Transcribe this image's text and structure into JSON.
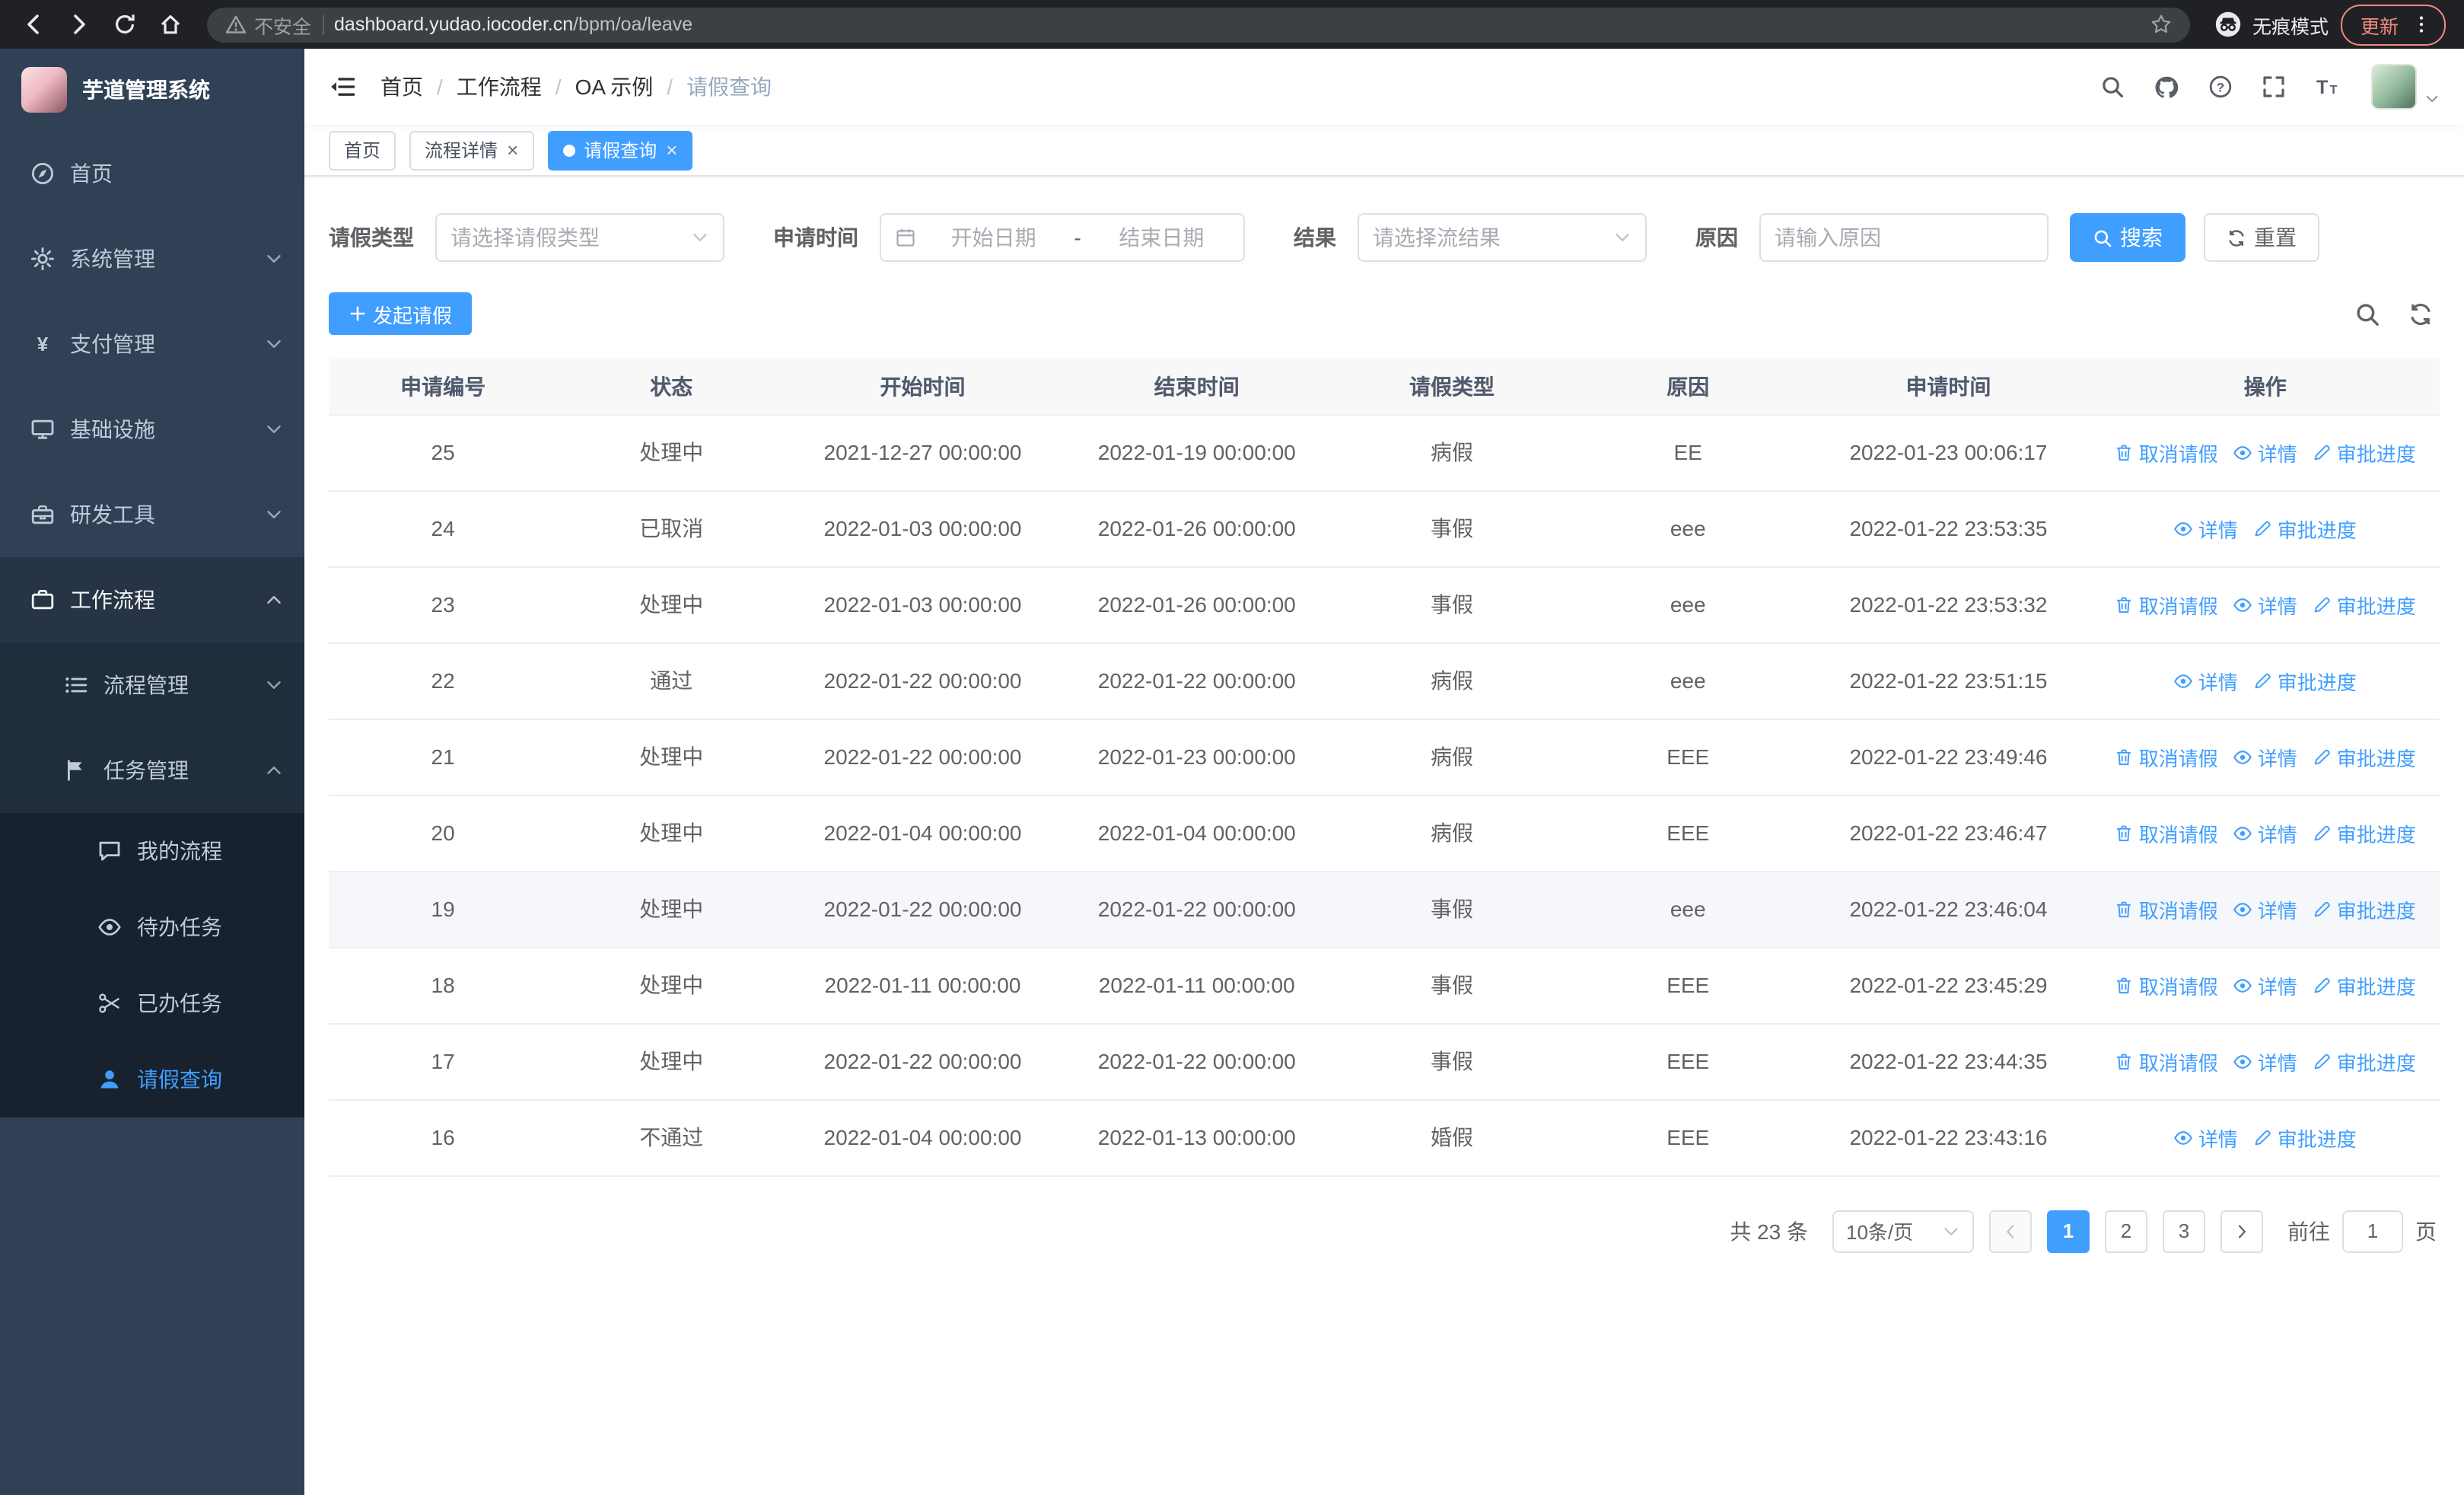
{
  "browser": {
    "security_warning": "不安全",
    "url_host": "dashboard.yudao.iocoder.cn",
    "url_path": "/bpm/oa/leave",
    "incognito_label": "无痕模式",
    "update_button": "更新",
    "nav_icons": [
      "back-icon",
      "forward-icon",
      "reload-icon",
      "home-icon"
    ]
  },
  "sidebar": {
    "logo_title": "芋道管理系统",
    "menu": [
      {
        "id": "home",
        "label": "首页",
        "icon": "dashboard-icon"
      },
      {
        "id": "system",
        "label": "系统管理",
        "icon": "gear-icon",
        "expandable": true
      },
      {
        "id": "payment",
        "label": "支付管理",
        "icon": "yen-icon",
        "expandable": true
      },
      {
        "id": "infra",
        "label": "基础设施",
        "icon": "infra-icon",
        "expandable": true
      },
      {
        "id": "devtools",
        "label": "研发工具",
        "icon": "tools-icon",
        "expandable": true
      },
      {
        "id": "workflow",
        "label": "工作流程",
        "icon": "workflow-icon",
        "expandable": true,
        "expanded": true,
        "children": [
          {
            "id": "process-manage",
            "label": "流程管理",
            "icon": "process-icon",
            "expandable": true
          },
          {
            "id": "task-manage",
            "label": "任务管理",
            "icon": "task-icon",
            "expandable": true,
            "expanded": true,
            "children": [
              {
                "id": "my-process",
                "label": "我的流程",
                "icon": "chat-icon"
              },
              {
                "id": "todo-task",
                "label": "待办任务",
                "icon": "eye-icon"
              },
              {
                "id": "done-task",
                "label": "已办任务",
                "icon": "done-icon"
              },
              {
                "id": "leave-query",
                "label": "请假查询",
                "icon": "user-icon",
                "active": true
              }
            ]
          }
        ]
      }
    ]
  },
  "header": {
    "breadcrumb": [
      "首页",
      "工作流程",
      "OA 示例",
      "请假查询"
    ],
    "icons": [
      "search-icon",
      "github-icon",
      "help-icon",
      "fullscreen-icon",
      "font-size-icon"
    ]
  },
  "tabs": [
    {
      "label": "首页",
      "closable": false,
      "active": false
    },
    {
      "label": "流程详情",
      "closable": true,
      "active": false
    },
    {
      "label": "请假查询",
      "closable": true,
      "active": true
    }
  ],
  "filters": {
    "leave_type": {
      "label": "请假类型",
      "placeholder": "请选择请假类型"
    },
    "apply_time": {
      "label": "申请时间",
      "start_placeholder": "开始日期",
      "separator": "-",
      "end_placeholder": "结束日期"
    },
    "result": {
      "label": "结果",
      "placeholder": "请选择流结果"
    },
    "reason": {
      "label": "原因",
      "placeholder": "请输入原因"
    },
    "search_button": "搜索",
    "reset_button": "重置"
  },
  "toolbar": {
    "create_button": "发起请假"
  },
  "table": {
    "columns": [
      "申请编号",
      "状态",
      "开始时间",
      "结束时间",
      "请假类型",
      "原因",
      "申请时间",
      "操作"
    ],
    "action_labels": {
      "cancel": "取消请假",
      "detail": "详情",
      "progress": "审批进度"
    },
    "rows": [
      {
        "id": "25",
        "status": "处理中",
        "start": "2021-12-27 00:00:00",
        "end": "2022-01-19 00:00:00",
        "type": "病假",
        "reason": "EE",
        "applied": "2022-01-23 00:06:17",
        "actions": [
          "cancel",
          "detail",
          "progress"
        ]
      },
      {
        "id": "24",
        "status": "已取消",
        "start": "2022-01-03 00:00:00",
        "end": "2022-01-26 00:00:00",
        "type": "事假",
        "reason": "eee",
        "applied": "2022-01-22 23:53:35",
        "actions": [
          "detail",
          "progress"
        ]
      },
      {
        "id": "23",
        "status": "处理中",
        "start": "2022-01-03 00:00:00",
        "end": "2022-01-26 00:00:00",
        "type": "事假",
        "reason": "eee",
        "applied": "2022-01-22 23:53:32",
        "actions": [
          "cancel",
          "detail",
          "progress"
        ]
      },
      {
        "id": "22",
        "status": "通过",
        "start": "2022-01-22 00:00:00",
        "end": "2022-01-22 00:00:00",
        "type": "病假",
        "reason": "eee",
        "applied": "2022-01-22 23:51:15",
        "actions": [
          "detail",
          "progress"
        ]
      },
      {
        "id": "21",
        "status": "处理中",
        "start": "2022-01-22 00:00:00",
        "end": "2022-01-23 00:00:00",
        "type": "病假",
        "reason": "EEE",
        "applied": "2022-01-22 23:49:46",
        "actions": [
          "cancel",
          "detail",
          "progress"
        ]
      },
      {
        "id": "20",
        "status": "处理中",
        "start": "2022-01-04 00:00:00",
        "end": "2022-01-04 00:00:00",
        "type": "病假",
        "reason": "EEE",
        "applied": "2022-01-22 23:46:47",
        "actions": [
          "cancel",
          "detail",
          "progress"
        ]
      },
      {
        "id": "19",
        "status": "处理中",
        "start": "2022-01-22 00:00:00",
        "end": "2022-01-22 00:00:00",
        "type": "事假",
        "reason": "eee",
        "applied": "2022-01-22 23:46:04",
        "actions": [
          "cancel",
          "detail",
          "progress"
        ],
        "hover": true
      },
      {
        "id": "18",
        "status": "处理中",
        "start": "2022-01-11 00:00:00",
        "end": "2022-01-11 00:00:00",
        "type": "事假",
        "reason": "EEE",
        "applied": "2022-01-22 23:45:29",
        "actions": [
          "cancel",
          "detail",
          "progress"
        ]
      },
      {
        "id": "17",
        "status": "处理中",
        "start": "2022-01-22 00:00:00",
        "end": "2022-01-22 00:00:00",
        "type": "事假",
        "reason": "EEE",
        "applied": "2022-01-22 23:44:35",
        "actions": [
          "cancel",
          "detail",
          "progress"
        ]
      },
      {
        "id": "16",
        "status": "不通过",
        "start": "2022-01-04 00:00:00",
        "end": "2022-01-13 00:00:00",
        "type": "婚假",
        "reason": "EEE",
        "applied": "2022-01-22 23:43:16",
        "actions": [
          "detail",
          "progress"
        ]
      }
    ]
  },
  "table_tools": [
    "search-icon",
    "refresh-icon"
  ],
  "pagination": {
    "total_text": "共 23 条",
    "page_size": "10条/页",
    "pages": [
      "1",
      "2",
      "3"
    ],
    "active_page": "1",
    "goto_label": "前往",
    "goto_value": "1",
    "goto_unit": "页"
  },
  "colors": {
    "primary": "#409eff",
    "sidebar_bg": "#304156",
    "sidebar_sub_bg": "#1f2d3d",
    "chrome_bg": "#202124",
    "update_red": "#f28b82"
  }
}
